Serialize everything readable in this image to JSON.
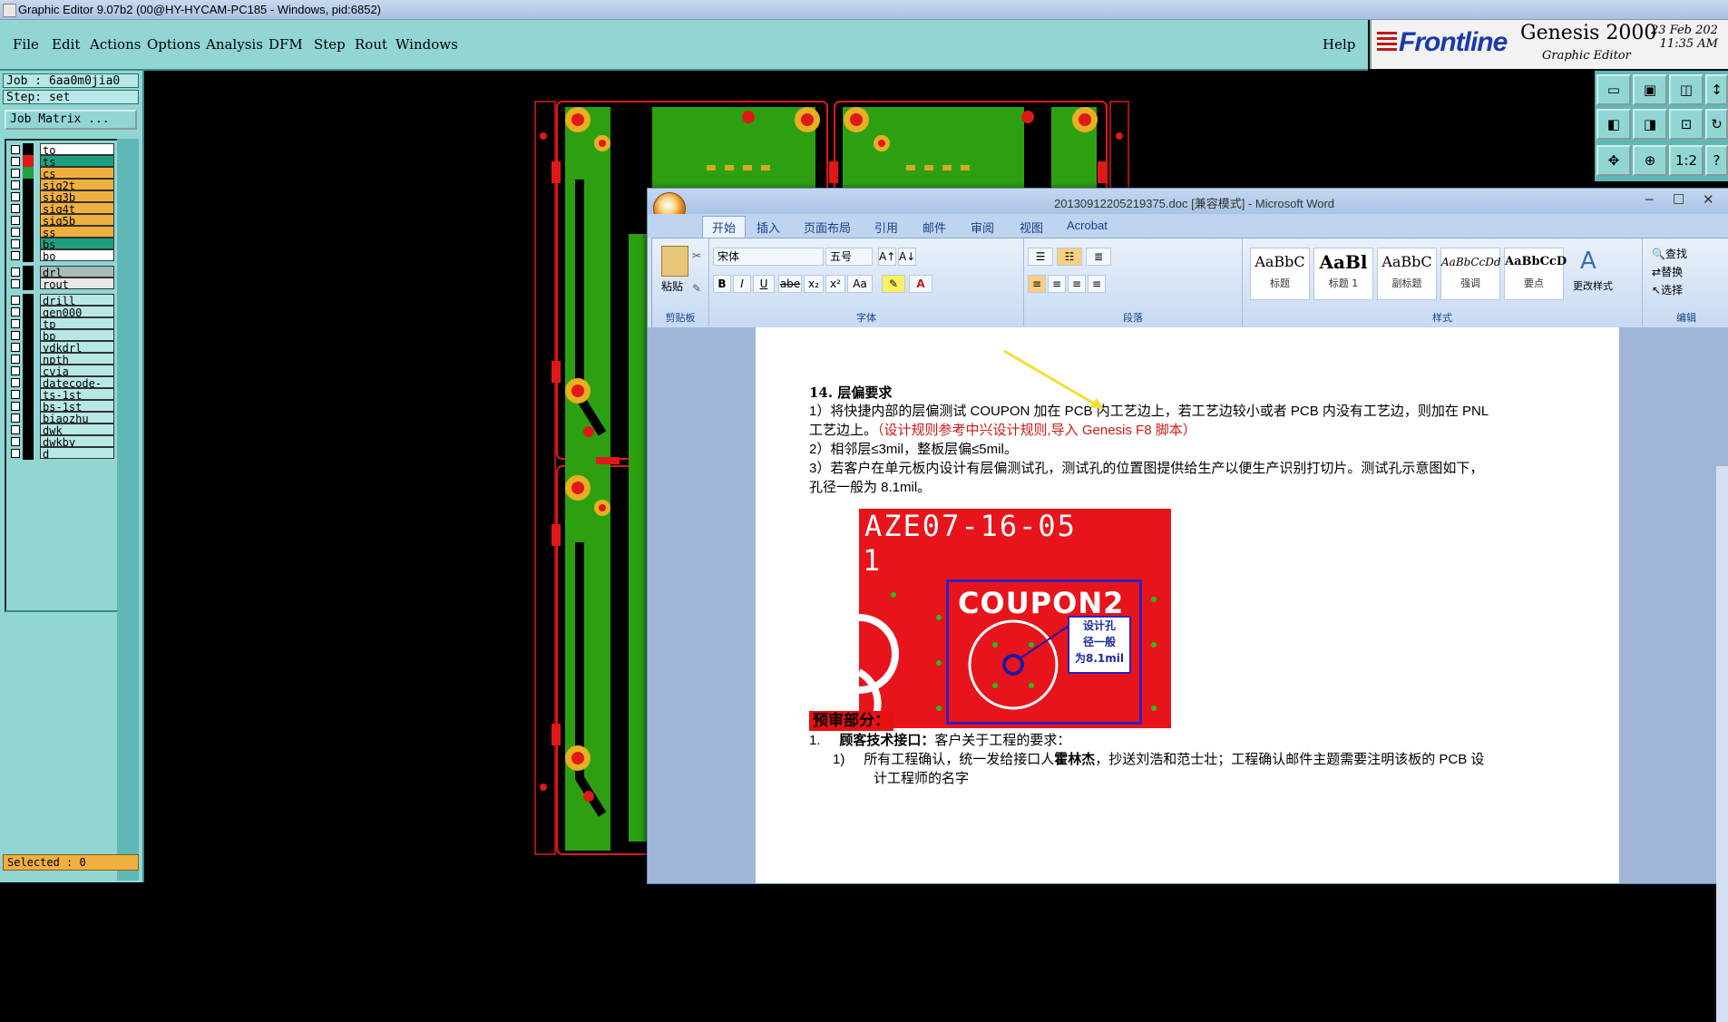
{
  "ge": {
    "title": "Graphic Editor 9.07b2 (00@HY-HYCAM-PC185 - Windows, pid:6852)",
    "menus": [
      "File",
      "Edit",
      "Actions",
      "Options",
      "Analysis",
      "DFM",
      "Step",
      "Rout",
      "Windows"
    ],
    "help": "Help",
    "brand": {
      "logo": "Frontline",
      "product": "Genesis 2000",
      "subtitle": "Graphic Editor",
      "date": "23 Feb 202",
      "time": "11:35 AM"
    },
    "job": "Job : 6aa0m0jia0",
    "step": "Step: set",
    "job_matrix": "Job Matrix ...",
    "layers": [
      {
        "name": "to",
        "color": "#ffffff",
        "swatch": "#000000"
      },
      {
        "name": "ts",
        "color": "#1ea080",
        "swatch": "#e01818"
      },
      {
        "name": "cs",
        "color": "#f0b040",
        "swatch": "#20a040"
      },
      {
        "name": "sig2t",
        "color": "#f0b040",
        "swatch": "#000000"
      },
      {
        "name": "sig3b",
        "color": "#f0b040",
        "swatch": "#000000"
      },
      {
        "name": "sig4t",
        "color": "#f0b040",
        "swatch": "#000000"
      },
      {
        "name": "sig5b",
        "color": "#f0b040",
        "swatch": "#000000"
      },
      {
        "name": "ss",
        "color": "#f0b040",
        "swatch": "#000000"
      },
      {
        "name": "bs",
        "color": "#1ea080",
        "swatch": "#000000"
      },
      {
        "name": "bo",
        "color": "#ffffff",
        "swatch": "#000000"
      },
      {
        "name": "drl",
        "color": "#a8bcbc",
        "swatch": "#000000"
      },
      {
        "name": "rout",
        "color": "#e8e8e8",
        "swatch": "#000000"
      },
      {
        "name": "drill",
        "color": "#b8e8e6",
        "swatch": "#000000"
      },
      {
        "name": "gen000",
        "color": "#b8e8e6",
        "swatch": "#000000"
      },
      {
        "name": "tp",
        "color": "#b8e8e6",
        "swatch": "#000000"
      },
      {
        "name": "bp",
        "color": "#b8e8e6",
        "swatch": "#000000"
      },
      {
        "name": "ydkdrl",
        "color": "#b8e8e6",
        "swatch": "#000000"
      },
      {
        "name": "npth",
        "color": "#b8e8e6",
        "swatch": "#000000"
      },
      {
        "name": "cvia",
        "color": "#b8e8e6",
        "swatch": "#000000"
      },
      {
        "name": "datecode-bo",
        "color": "#b8e8e6",
        "swatch": "#000000"
      },
      {
        "name": "ts-1st",
        "color": "#b8e8e6",
        "swatch": "#000000"
      },
      {
        "name": "bs-1st",
        "color": "#b8e8e6",
        "swatch": "#000000"
      },
      {
        "name": "biaozhu",
        "color": "#b8e8e6",
        "swatch": "#000000"
      },
      {
        "name": "dwk",
        "color": "#b8e8e6",
        "swatch": "#000000"
      },
      {
        "name": "dwkby",
        "color": "#b8e8e6",
        "swatch": "#000000"
      },
      {
        "name": "d",
        "color": "#b8e8e6",
        "swatch": "#000000"
      }
    ],
    "selected": "Selected : 0",
    "tool_icons": [
      "fit-icon",
      "zoom-in-icon",
      "zoom-out-icon",
      "pan-icon",
      "measure-icon",
      "snap-icon",
      "grid-icon",
      "help-icon"
    ],
    "tool_labels": [
      "1:2",
      "?"
    ]
  },
  "word": {
    "title": "20130912205219375.doc [兼容模式] - Microsoft Word",
    "tabs": [
      "开始",
      "插入",
      "页面布局",
      "引用",
      "邮件",
      "审阅",
      "视图",
      "Acrobat"
    ],
    "clipboard": {
      "paste": "粘贴",
      "label": "剪贴板"
    },
    "font": {
      "name": "宋体",
      "size": "五号",
      "label": "字体",
      "bold": "B",
      "italic": "I",
      "underline": "U",
      "strike": "abe",
      "sub": "x₂",
      "sup": "x²",
      "case": "Aa",
      "grow": "A↑",
      "shrink": "A↓"
    },
    "paragraph_label": "段落",
    "styles": [
      {
        "sample": "AaBbC",
        "name": "标题"
      },
      {
        "sample": "AaBl",
        "name": "标题 1"
      },
      {
        "sample": "AaBbC",
        "name": "副标题"
      },
      {
        "sample": "AaBbCcDd",
        "name": "强调"
      },
      {
        "sample": "AaBbCcD",
        "name": "要点"
      }
    ],
    "styles_label": "样式",
    "change_styles": "更改样式",
    "edit": {
      "find": "查找",
      "replace": "替换",
      "select": "选择",
      "label": "编辑"
    },
    "doc": {
      "heading": "14. 层偏要求",
      "p1a": "1）将快捷内部的层偏测试 COUPON  加在 PCB 内工艺边上，若工艺边较小或者 PCB 内没有工艺边，则加在 PNL",
      "p1b": "工艺边上。",
      "p1c": "（设计规则参考中兴设计规则,导入 Genesis F8 脚本）",
      "p2": "2）相邻层≤3mil，整板层偏≤5mil。",
      "p3a": "3）若客户在单元板内设计有层偏测试孔，测试孔的位置图提供给生产以便生产识别打切片。测试孔示意图如下，",
      "p3b": "孔径一般为 8.1mil。",
      "img_line1": "AZE07-16-05",
      "img_line2": "1",
      "img_coupon": "COUPON2",
      "img_callout": [
        "设计孔",
        "径一般",
        "为8.1mil"
      ],
      "review": "预审部分：",
      "item1_num": "1.",
      "item1_bold": "顾客技术接口：",
      "item1_text": "客户关于工程的要求：",
      "sub1_num": "1)",
      "sub1_a": "所有工程确认，统一发给接口人",
      "sub1_bold": "霍林杰",
      "sub1_b": "，抄送刘浩和范士壮；工程确认邮件主题需要注明该板的 PCB 设",
      "sub1_c": "计工程师的名字"
    }
  }
}
